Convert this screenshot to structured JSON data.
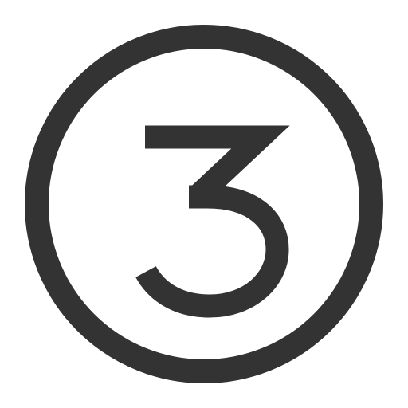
{
  "icon": {
    "name": "circled-number-three-icon",
    "digit": "3",
    "stroke_color": "#333333",
    "background_color": "#ffffff"
  }
}
